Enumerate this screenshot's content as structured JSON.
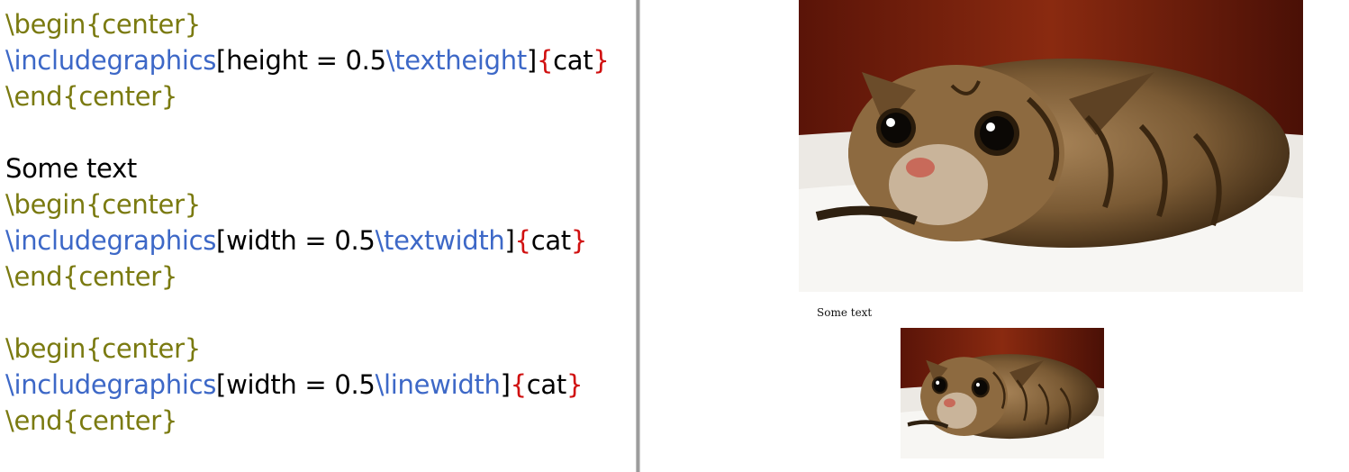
{
  "editor": {
    "lines": [
      {
        "env_begin": "\\begin{center}"
      },
      {
        "cmd": "\\includegraphics",
        "opt_open": "[",
        "opt_key": "height = 0.5",
        "opt_cmd": "\\textheight",
        "opt_close": "]",
        "b_open": "{",
        "arg": "cat",
        "b_close": "}"
      },
      {
        "env_end": "\\end{center}"
      },
      {
        "text": "Some text"
      },
      {
        "env_begin": "\\begin{center}"
      },
      {
        "cmd": "\\includegraphics",
        "opt_open": "[",
        "opt_key": "width = 0.5",
        "opt_cmd": "\\textwidth",
        "opt_close": "]",
        "b_open": "{",
        "arg": "cat",
        "b_close": "}"
      },
      {
        "env_end": "\\end{center}"
      },
      {
        "env_begin": "\\begin{center}"
      },
      {
        "cmd": "\\includegraphics",
        "opt_open": "[",
        "opt_key": "width = 0.5",
        "opt_cmd": "\\linewidth",
        "opt_close": "]",
        "b_open": "{",
        "arg": "cat",
        "b_close": "}"
      },
      {
        "env_end": "\\end{center}"
      }
    ]
  },
  "preview": {
    "body_text": "Some text",
    "images": [
      {
        "name": "cat-image-large",
        "icon": "cat-photo"
      },
      {
        "name": "cat-image-small",
        "icon": "cat-photo"
      }
    ]
  },
  "colors": {
    "environment": "#7a7a10",
    "command": "#3d68c7",
    "brace": "#d01010",
    "text": "#000000"
  }
}
